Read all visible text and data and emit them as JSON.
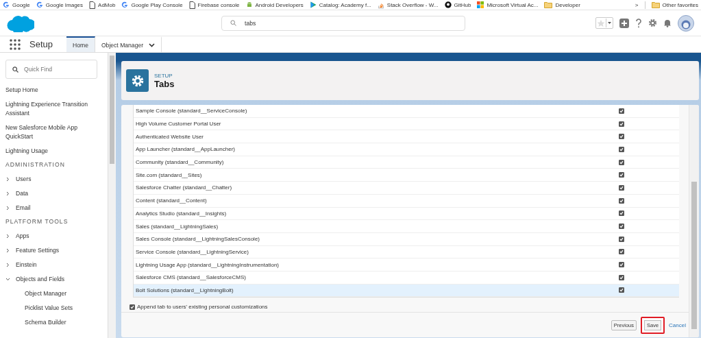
{
  "bookmarks": [
    {
      "label": "Google"
    },
    {
      "label": "Google Images"
    },
    {
      "label": "AdMob"
    },
    {
      "label": "Google Play Console"
    },
    {
      "label": "Firebase console"
    },
    {
      "label": "Android Developers"
    },
    {
      "label": "Catalog: Academy f..."
    },
    {
      "label": "Stack Overflow - W..."
    },
    {
      "label": "GitHub"
    },
    {
      "label": "Microsoft Virtual Ac..."
    },
    {
      "label": "Developer"
    }
  ],
  "bookmarks_overflow": ">",
  "other_favorites": "Other favorites",
  "search": {
    "value": "tabs"
  },
  "nav": {
    "app_name": "Setup",
    "tabs": [
      {
        "label": "Home",
        "selected": true,
        "dropdown": false
      },
      {
        "label": "Object Manager",
        "selected": false,
        "dropdown": true
      }
    ]
  },
  "sidebar": {
    "quick_find": {
      "placeholder": "Quick Find"
    },
    "items": [
      {
        "kind": "link",
        "label": "Setup Home"
      },
      {
        "kind": "link",
        "label": "Lightning Experience Transition Assistant"
      },
      {
        "kind": "link",
        "label": "New Salesforce Mobile App QuickStart"
      },
      {
        "kind": "link",
        "label": "Lightning Usage"
      },
      {
        "kind": "section",
        "label": "ADMINISTRATION"
      },
      {
        "kind": "group",
        "label": "Users",
        "expanded": false
      },
      {
        "kind": "group",
        "label": "Data",
        "expanded": false
      },
      {
        "kind": "group",
        "label": "Email",
        "expanded": false
      },
      {
        "kind": "section",
        "label": "PLATFORM TOOLS"
      },
      {
        "kind": "group",
        "label": "Apps",
        "expanded": false
      },
      {
        "kind": "group",
        "label": "Feature Settings",
        "expanded": false
      },
      {
        "kind": "group",
        "label": "Einstein",
        "expanded": false
      },
      {
        "kind": "group",
        "label": "Objects and Fields",
        "expanded": true,
        "children": [
          {
            "kind": "link",
            "label": "Object Manager"
          },
          {
            "kind": "link",
            "label": "Picklist Value Sets"
          },
          {
            "kind": "link",
            "label": "Schema Builder"
          }
        ]
      }
    ]
  },
  "page_header": {
    "eyebrow": "SETUP",
    "title": "Tabs"
  },
  "table": {
    "rows": [
      {
        "name": "Sample Console (standard__ServiceConsole)",
        "checked": true,
        "selected": false
      },
      {
        "name": "High Volume Customer Portal User",
        "checked": true,
        "selected": false
      },
      {
        "name": "Authenticated Website User",
        "checked": true,
        "selected": false
      },
      {
        "name": "App Launcher (standard__AppLauncher)",
        "checked": true,
        "selected": false
      },
      {
        "name": "Community (standard__Community)",
        "checked": true,
        "selected": false
      },
      {
        "name": "Site.com (standard__Sites)",
        "checked": true,
        "selected": false
      },
      {
        "name": "Salesforce Chatter (standard__Chatter)",
        "checked": true,
        "selected": false
      },
      {
        "name": "Content (standard__Content)",
        "checked": true,
        "selected": false
      },
      {
        "name": "Analytics Studio (standard__Insights)",
        "checked": true,
        "selected": false
      },
      {
        "name": "Sales (standard__LightningSales)",
        "checked": true,
        "selected": false
      },
      {
        "name": "Sales Console (standard__LightningSalesConsole)",
        "checked": true,
        "selected": false
      },
      {
        "name": "Service Console (standard__LightningService)",
        "checked": true,
        "selected": false
      },
      {
        "name": "Lightning Usage App (standard__LightningInstrumentation)",
        "checked": true,
        "selected": false
      },
      {
        "name": "Salesforce CMS (standard__SalesforceCMS)",
        "checked": true,
        "selected": false
      },
      {
        "name": "Bolt Solutions (standard__LightningBolt)",
        "checked": true,
        "selected": true
      }
    ]
  },
  "append_option": {
    "label": "Append tab to users' existing personal customizations",
    "checked": true
  },
  "buttons": [
    {
      "label": "Previous",
      "kind": "button",
      "highlighted": false
    },
    {
      "label": "Save",
      "kind": "button",
      "highlighted": true
    },
    {
      "label": "Cancel",
      "kind": "link",
      "highlighted": false
    }
  ]
}
